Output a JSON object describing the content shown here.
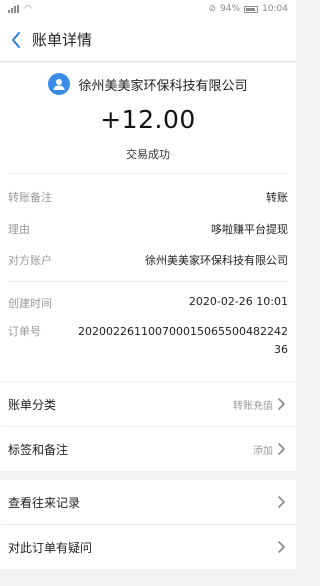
{
  "statusbar": {
    "battery": "94%",
    "time": "10:04"
  },
  "navbar": {
    "title": "账单详情"
  },
  "merchant": {
    "name": "徐州美美家环保科技有限公司",
    "avatar_icon": "person-icon",
    "avatar_color": "#3b8ce6"
  },
  "amount": "+12.00",
  "status": "交易成功",
  "details": [
    {
      "label": "转账备注",
      "value": "转账"
    },
    {
      "label": "理由",
      "value": "哆啦赚平台提现"
    },
    {
      "label": "对方账户",
      "value": "徐州美美家环保科技有限公司"
    },
    {
      "label": "创建时间",
      "value": "2020-02-26 10:01"
    },
    {
      "label": "订单号",
      "value": "2020022611007000150655004822423 6"
    }
  ],
  "order_number": "20200226110070001506550048224236",
  "menu": [
    {
      "label": "账单分类",
      "hint": "转账充值"
    },
    {
      "label": "标签和备注",
      "hint": "添加"
    },
    {
      "label": "查看往来记录",
      "hint": ""
    },
    {
      "label": "对此订单有疑问",
      "hint": ""
    }
  ]
}
